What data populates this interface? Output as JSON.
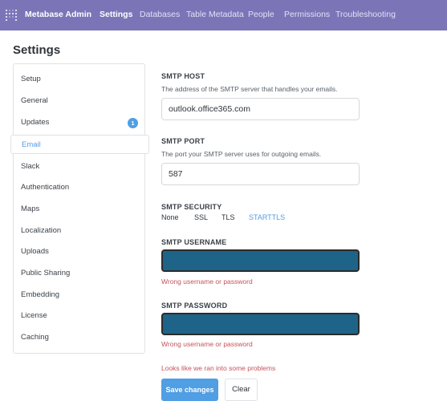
{
  "topbar": {
    "logo_icon": "metabase-logo-icon",
    "brand": "Metabase Admin",
    "nav": [
      "Settings",
      "Databases",
      "Table Metadata",
      "People",
      "Permissions",
      "Troubleshooting"
    ]
  },
  "page": {
    "title": "Settings"
  },
  "sidebar": {
    "items": [
      {
        "label": "Setup"
      },
      {
        "label": "General"
      },
      {
        "label": "Updates",
        "badge": "1"
      },
      {
        "label": "Email"
      },
      {
        "label": "Slack"
      },
      {
        "label": "Authentication"
      },
      {
        "label": "Maps"
      },
      {
        "label": "Localization"
      },
      {
        "label": "Uploads"
      },
      {
        "label": "Public Sharing"
      },
      {
        "label": "Embedding"
      },
      {
        "label": "License"
      },
      {
        "label": "Caching"
      }
    ]
  },
  "smtp": {
    "host": {
      "label": "SMTP HOST",
      "description": "The address of the SMTP server that handles your emails.",
      "value": "outlook.office365.com"
    },
    "port": {
      "label": "SMTP PORT",
      "description": "The port your SMTP server uses for outgoing emails.",
      "value": "587"
    },
    "security": {
      "label": "SMTP SECURITY",
      "options": [
        "None",
        "SSL",
        "TLS",
        "STARTTLS"
      ],
      "selected": "STARTTLS"
    },
    "username": {
      "label": "SMTP USERNAME",
      "error": "Wrong username or password"
    },
    "password": {
      "label": "SMTP PASSWORD",
      "error": "Wrong username or password"
    }
  },
  "form_error": "Looks like we ran into some problems",
  "buttons": {
    "save": "Save changes",
    "clear": "Clear"
  },
  "colors": {
    "topbar": "#7b75b8",
    "accent": "#509ee3",
    "error": "#c4535c",
    "redacted": "#1e6489"
  }
}
